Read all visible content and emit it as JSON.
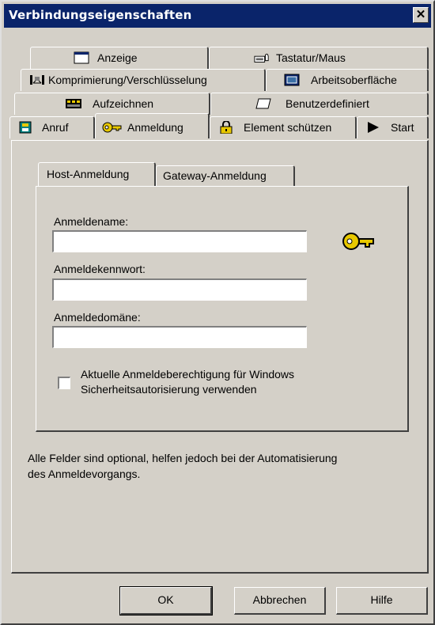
{
  "window": {
    "title": "Verbindungseigenschaften",
    "close_glyph": "✕"
  },
  "tabs": {
    "row1": [
      {
        "label": "Anzeige",
        "icon": "display-icon"
      },
      {
        "label": "Tastatur/Maus",
        "icon": "keyboard-mouse-icon"
      }
    ],
    "row2": [
      {
        "label": "Komprimierung/Verschlüsselung",
        "icon": "compression-icon"
      },
      {
        "label": "Arbeitsoberfläche",
        "icon": "desktop-icon"
      }
    ],
    "row3": [
      {
        "label": "Aufzeichnen",
        "icon": "record-icon"
      },
      {
        "label": "Benutzerdefiniert",
        "icon": "custom-icon"
      }
    ],
    "row4": [
      {
        "label": "Anruf",
        "icon": "phonebook-icon"
      },
      {
        "label": "Anmeldung",
        "icon": "key-icon",
        "active": true
      },
      {
        "label": "Element schützen",
        "icon": "lock-icon"
      },
      {
        "label": "Start",
        "icon": "play-icon"
      }
    ]
  },
  "login": {
    "tabs": [
      {
        "label": "Host-Anmeldung",
        "active": true
      },
      {
        "label": "Gateway-Anmeldung"
      }
    ],
    "fields": {
      "username": {
        "label": "Anmeldename:",
        "value": ""
      },
      "password": {
        "label": "Anmeldekennwort:",
        "value": ""
      },
      "domain": {
        "label": "Anmeldedomäne:",
        "value": ""
      }
    },
    "checkbox": {
      "label_line1": "Aktuelle Anmeldeberechtigung für Windows",
      "label_line2": "Sicherheitsautorisierung verwenden",
      "checked": false
    }
  },
  "note": {
    "line1": "Alle Felder sind optional, helfen jedoch bei der Automatisierung",
    "line2": "des Anmeldevorgangs."
  },
  "buttons": {
    "ok": "OK",
    "cancel": "Abbrechen",
    "help": "Hilfe"
  },
  "colors": {
    "titlebar": "#0a246a",
    "face": "#d4d0c8",
    "key_gold": "#e8c800"
  }
}
